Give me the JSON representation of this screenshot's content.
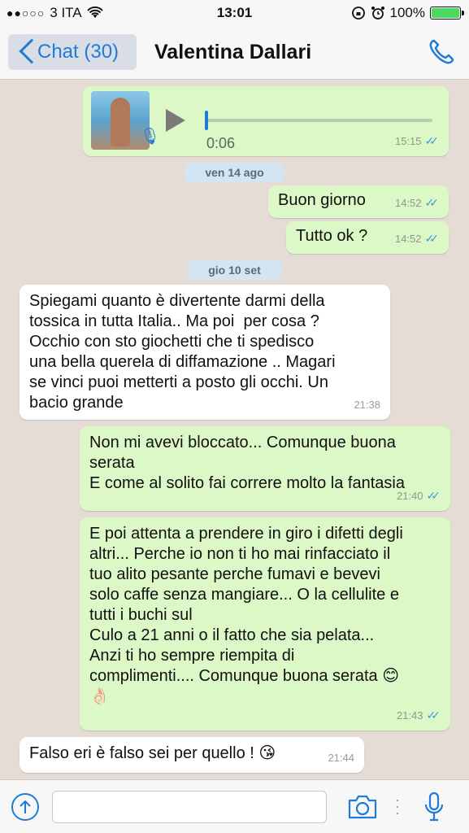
{
  "status_bar": {
    "signal": "●●○○○",
    "carrier": "3 ITA",
    "wifi": "wifi-icon",
    "time": "13:01",
    "battery": "100%",
    "battery_level": 1.0
  },
  "nav": {
    "back_label": "Chat (30)",
    "contact_name": "Valentina Dallari"
  },
  "chat": {
    "voice_note": {
      "duration": "0:06",
      "time": "15:15"
    },
    "date_1": "ven 14 ago",
    "msg_1": {
      "text": "Buon giorno",
      "time": "14:52"
    },
    "msg_2": {
      "text": "Tutto ok ?",
      "time": "14:52"
    },
    "date_2": "gio 10 set",
    "msg_3": {
      "text": "Spiegami quanto è divertente darmi della\ntossica in tutta Italia.. Ma poi  per cosa ?\nOcchio con sto giochetti che ti spedisco\nuna bella querela di diffamazione .. Magari\nse vinci puoi metterti a posto gli occhi. Un\nbacio grande",
      "time": "21:38"
    },
    "msg_4": {
      "text": "Non mi avevi bloccato... Comunque buona\nserata\nE come al solito fai correre molto la fantasia",
      "time": "21:40"
    },
    "msg_5": {
      "text": "E poi attenta a prendere in giro i difetti degli\naltri... Perche io non ti ho mai rinfacciato il\ntuo alito pesante perche fumavi e bevevi\nsolo caffe senza mangiare... O la cellulite e\ntutti i buchi sul\nCulo a 21 anni o il fatto che sia pelata...\nAnzi ti ho sempre riempita di\ncomplimenti.... Comunque buona serata 😊\n👌🏻",
      "time": "21:43"
    },
    "msg_6": {
      "text": "Falso eri è falso sei per quello ! 😘",
      "time": "21:44"
    }
  },
  "input": {
    "placeholder": ""
  },
  "colors": {
    "accent": "#1f7bd6",
    "outgoing_bubble": "#dcf8c6",
    "incoming_bubble": "#ffffff",
    "read_ticks": "#3b9cdc"
  }
}
